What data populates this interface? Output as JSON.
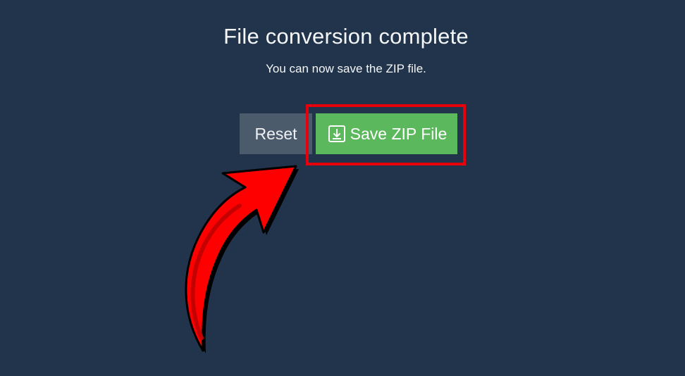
{
  "dialog": {
    "title": "File conversion complete",
    "message": "You can now save the ZIP file."
  },
  "actions": {
    "reset_label": "Reset",
    "save_label": "Save ZIP File",
    "save_icon": "download-icon"
  },
  "annotation": {
    "highlight_color": "#e8000b",
    "arrow_color": "#ff0000"
  },
  "colors": {
    "background": "#21344b",
    "reset_button": "#4c5b6b",
    "save_button": "#5cb85c"
  }
}
